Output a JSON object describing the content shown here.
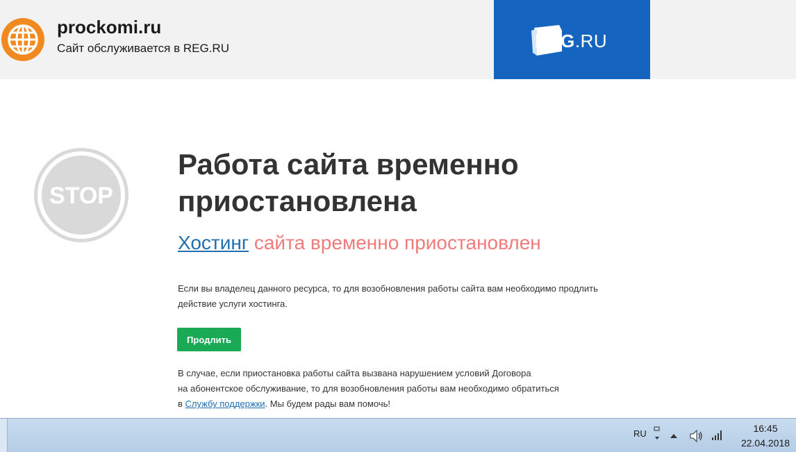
{
  "header": {
    "site_name": "prockomi.ru",
    "site_sub": "Сайт обслуживается в REG.RU",
    "reg_logo_main": "REG",
    "reg_logo_sep": ".",
    "reg_logo_tld": "RU",
    "icon": "globe-icon"
  },
  "stop_sign": {
    "label": "STOP",
    "icon": "stop-sign-icon"
  },
  "main": {
    "title": "Работа сайта временно приостановлена",
    "subtitle_link": "Хостинг",
    "subtitle_rest": "сайта временно приостановлен",
    "para1": "Если вы владелец данного ресурса, то для возобновления работы сайта вам необходимо продлить действие услуги хостинга.",
    "button_label": "Продлить",
    "para2_line1": "В случае, если приостановка работы сайта вызвана нарушением условий Договора",
    "para2_line2": "на абонентское обслуживание, то для возобновления работы вам необходимо обратиться",
    "para2_prefix": "в",
    "para2_link": "Службу поддержки",
    "para2_suffix": ". Мы будем рады вам помочь!"
  },
  "taskbar": {
    "lang": "RU",
    "time": "16:45",
    "date": "22.04.2018"
  },
  "colors": {
    "reg_blue": "#1565c0",
    "button_green": "#1aaa55",
    "link_blue": "#1f6fb2",
    "subtitle_red": "#ef7b7b",
    "globe_orange": "#f0891f"
  }
}
